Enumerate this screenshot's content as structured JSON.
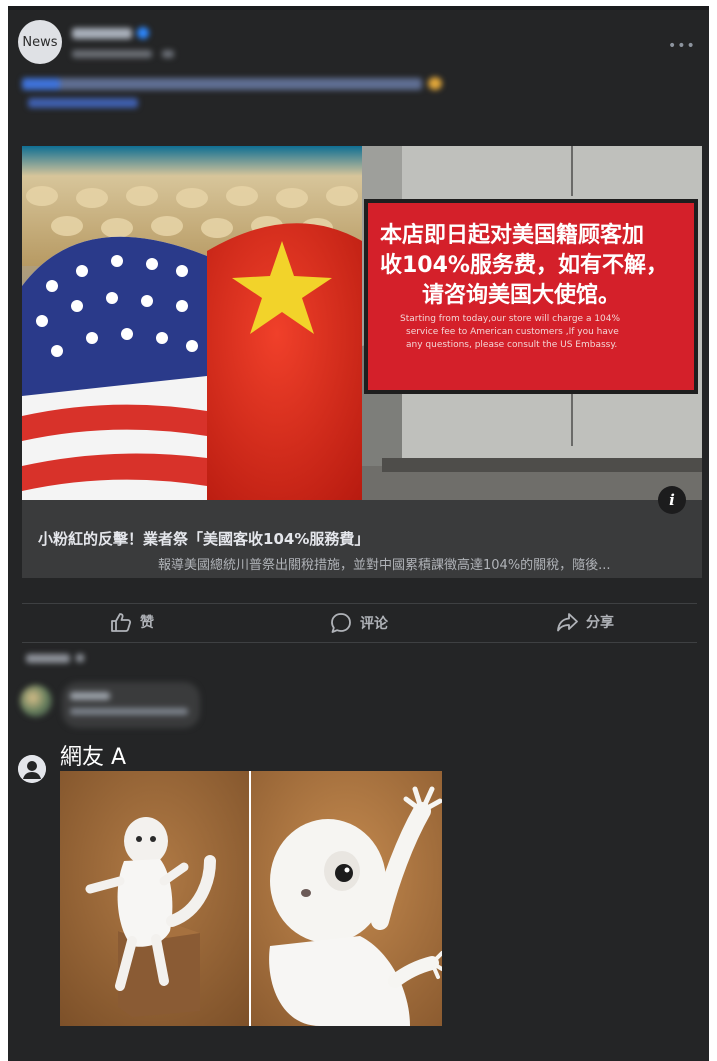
{
  "post": {
    "page_avatar_text": "News",
    "menu_label": "•••"
  },
  "link_card": {
    "title": "小粉紅的反擊！業者祭「美國客收104%服務費」",
    "description": "報導美國總統川普祭出關稅措施，並對中國累積課徵高達104%的關稅，隨後...",
    "info_label": "i",
    "sign": {
      "line1": "本店即日起对美国籍顾客加",
      "line2": "收104%服务费，如有不解，",
      "line3": "请咨询美国大使馆。",
      "en1": "Starting from today,our store will charge a 104%",
      "en2": "service fee to American customers ,If you have",
      "en3": "any questions, please consult the US Embassy."
    }
  },
  "actions": {
    "like": "赞",
    "comment": "评论",
    "share": "分享"
  },
  "comment": {
    "user_name": "網友 A"
  },
  "colors": {
    "background": "#242526",
    "card": "#3a3b3c",
    "text_primary": "#e4e6eb",
    "text_secondary": "#b0b3b8",
    "sign_red": "#d4202a"
  }
}
